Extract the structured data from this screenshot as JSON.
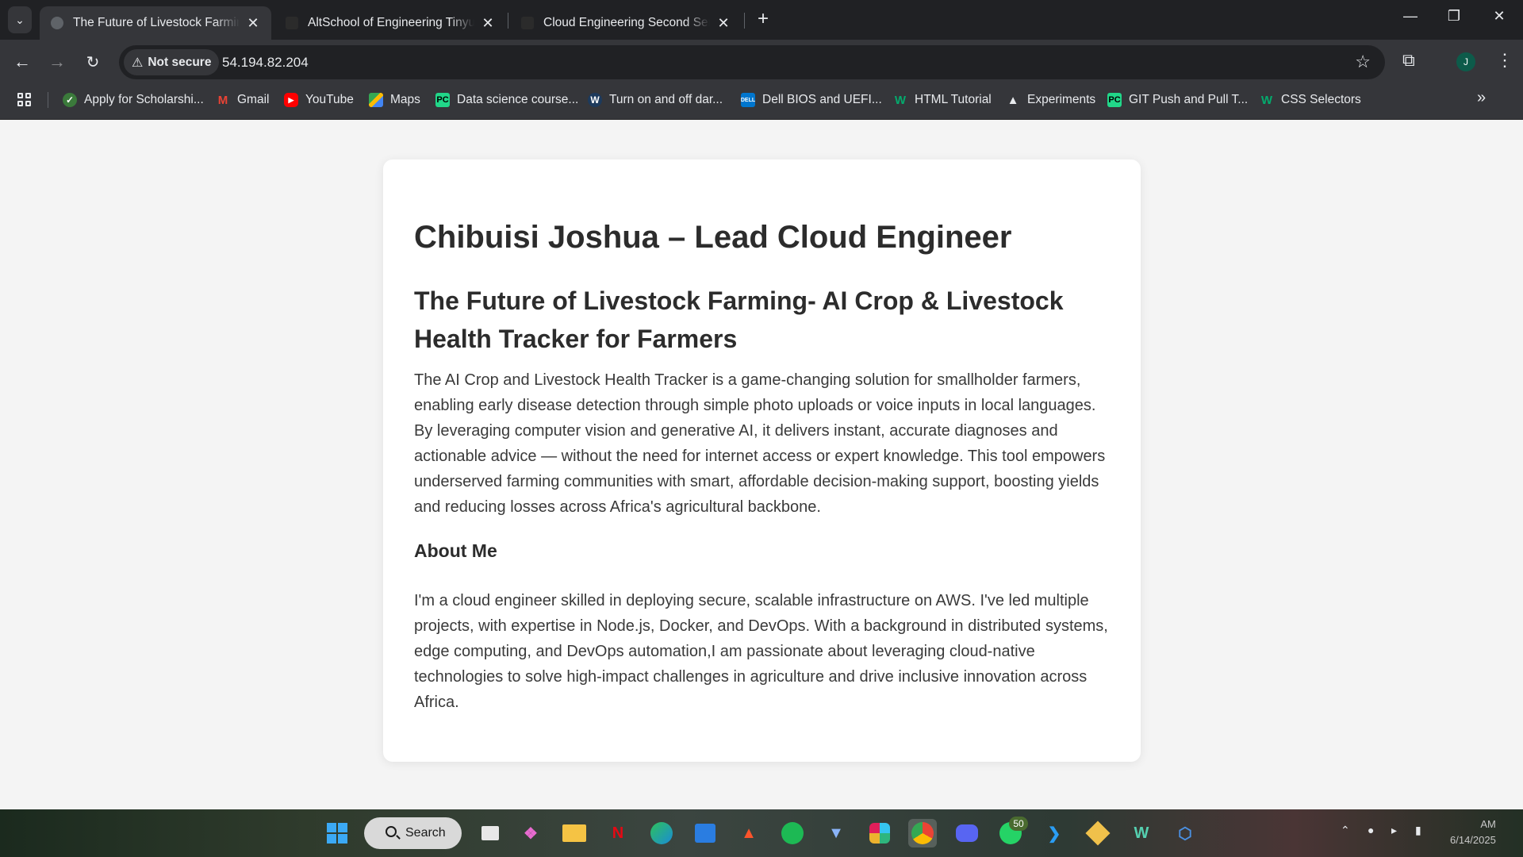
{
  "browser": {
    "tabs": [
      {
        "title": "The Future of Livestock Farming"
      },
      {
        "title": "AltSchool of Engineering Tinyuka"
      },
      {
        "title": "Cloud Engineering Second Semester"
      }
    ],
    "security_label": "Not secure",
    "url": "54.194.82.204",
    "profile_initial": "J"
  },
  "bookmarks": [
    {
      "label": "Apply for Scholarshi...",
      "icon": "scholarship-icon"
    },
    {
      "label": "Gmail",
      "icon": "gmail-icon"
    },
    {
      "label": "YouTube",
      "icon": "youtube-icon"
    },
    {
      "label": "Maps",
      "icon": "maps-icon"
    },
    {
      "label": "Data science course...",
      "icon": "pycharm-icon"
    },
    {
      "label": "Turn on and off dar...",
      "icon": "w-icon"
    },
    {
      "label": "Dell BIOS and UEFI...",
      "icon": "dell-icon"
    },
    {
      "label": "HTML Tutorial",
      "icon": "w3schools-icon"
    },
    {
      "label": "Experiments",
      "icon": "flask-icon"
    },
    {
      "label": "GIT Push and Pull T...",
      "icon": "pycharm-icon"
    },
    {
      "label": "CSS Selectors",
      "icon": "w3schools-icon"
    }
  ],
  "page": {
    "heading": "Chibuisi Joshua – Lead Cloud Engineer",
    "subheading": "The Future of Livestock Farming- AI Crop & Livestock Health Tracker for Farmers",
    "intro": "The AI Crop and Livestock Health Tracker is a game-changing solution for smallholder farmers, enabling early disease detection through simple photo uploads or voice inputs in local languages. By leveraging computer vision and generative AI, it delivers instant, accurate diagnoses and actionable advice — without the need for internet access or expert knowledge. This tool empowers underserved farming communities with smart, affordable decision-making support, boosting yields and reducing losses across Africa's agricultural backbone.",
    "about_heading": "About Me",
    "about_text": "I'm a cloud engineer skilled in deploying secure, scalable infrastructure on AWS. I've led multiple projects, with expertise in Node.js, Docker, and DevOps. With a background in distributed systems, edge computing, and DevOps automation,I am passionate about leveraging cloud-native technologies to solve high-impact challenges in agriculture and drive inclusive innovation across Africa."
  },
  "taskbar": {
    "search_label": "Search",
    "whatsapp_badge": "50",
    "clock_time": "AM",
    "clock_date": "6/14/2025"
  }
}
